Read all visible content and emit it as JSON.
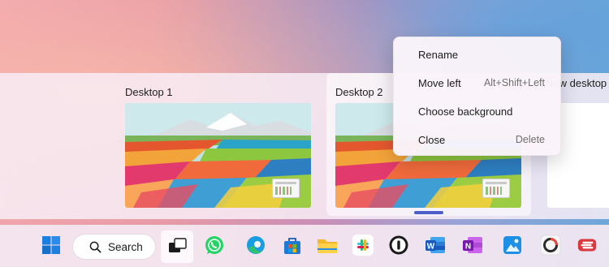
{
  "desktops": [
    {
      "label": "Desktop 1"
    },
    {
      "label": "Desktop 2"
    }
  ],
  "new_desktop": {
    "label": "New desktop"
  },
  "context_menu": {
    "items": [
      {
        "label": "Rename",
        "shortcut": ""
      },
      {
        "label": "Move left",
        "shortcut": "Alt+Shift+Left"
      },
      {
        "label": "Choose background",
        "shortcut": ""
      },
      {
        "label": "Close",
        "shortcut": "Delete"
      }
    ]
  },
  "taskbar": {
    "search_label": "Search",
    "apps": [
      "start-icon",
      "task-view-icon",
      "whatsapp-icon",
      "edge-icon",
      "store-icon",
      "file-explorer-icon",
      "slack-icon",
      "1password-icon",
      "word-icon",
      "onenote-icon",
      "photos-icon",
      "capture-icon",
      "expressvpn-icon"
    ]
  },
  "colors": {
    "accent": "#4f5fc9",
    "menu_bg": "#faf4fa"
  }
}
